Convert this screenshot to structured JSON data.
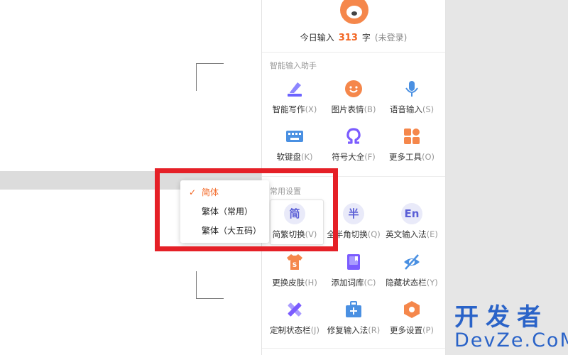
{
  "watermark": {
    "cn": "开发者",
    "en": "DevZe.CoM"
  },
  "panel": {
    "stats": {
      "prefix": "今日输入",
      "count": "313",
      "unit": "字",
      "status": "(未登录)"
    },
    "sections": [
      {
        "title": "智能输入助手",
        "items": [
          {
            "label": "智能写作",
            "key": "(X)",
            "icon": "pen-icon",
            "color": "#6c63ff"
          },
          {
            "label": "图片表情",
            "key": "(B)",
            "icon": "smiley-icon",
            "color": "#f5874b"
          },
          {
            "label": "语音输入",
            "key": "(S)",
            "icon": "microphone-icon",
            "color": "#4a90e2"
          },
          {
            "label": "软键盘",
            "key": "(K)",
            "icon": "keyboard-icon",
            "color": "#4a90e2"
          },
          {
            "label": "符号大全",
            "key": "(F)",
            "icon": "omega-icon",
            "color": "#7b5cff"
          },
          {
            "label": "更多工具",
            "key": "(O)",
            "icon": "grid-icon",
            "color": "#f5874b"
          }
        ]
      },
      {
        "title": "常用设置",
        "items": [
          {
            "label": "简繁切换",
            "key": "(V)",
            "icon": "simplified-icon",
            "glyph": "简"
          },
          {
            "label": "全半角切换",
            "key": "(Q)",
            "icon": "half-width-icon",
            "glyph": "半"
          },
          {
            "label": "英文输入法",
            "key": "(E)",
            "icon": "english-icon",
            "glyph": "En"
          },
          {
            "label": "更换皮肤",
            "key": "(H)",
            "icon": "shirt-icon",
            "color": "#f5874b"
          },
          {
            "label": "添加词库",
            "key": "(C)",
            "icon": "book-icon",
            "color": "#7b5cff"
          },
          {
            "label": "隐藏状态栏",
            "key": "(Y)",
            "icon": "eye-hidden-icon",
            "color": "#4a90e2"
          },
          {
            "label": "定制状态栏",
            "key": "(J)",
            "icon": "ruler-pencil-icon",
            "color": "#7b5cff"
          },
          {
            "label": "修复输入法",
            "key": "(R)",
            "icon": "toolbox-icon",
            "color": "#4a90e2"
          },
          {
            "label": "更多设置",
            "key": "(P)",
            "icon": "hexagon-settings-icon",
            "color": "#f5874b"
          }
        ]
      }
    ]
  },
  "dropdown": {
    "check": "✓",
    "options": [
      {
        "label": "简体",
        "selected": true
      },
      {
        "label": "繁体（常用）",
        "selected": false
      },
      {
        "label": "繁体（大五码）",
        "selected": false
      }
    ]
  },
  "colors": {
    "accent": "#f26522",
    "highlight_box": "#e52027",
    "watermark": "#2a63c8"
  }
}
